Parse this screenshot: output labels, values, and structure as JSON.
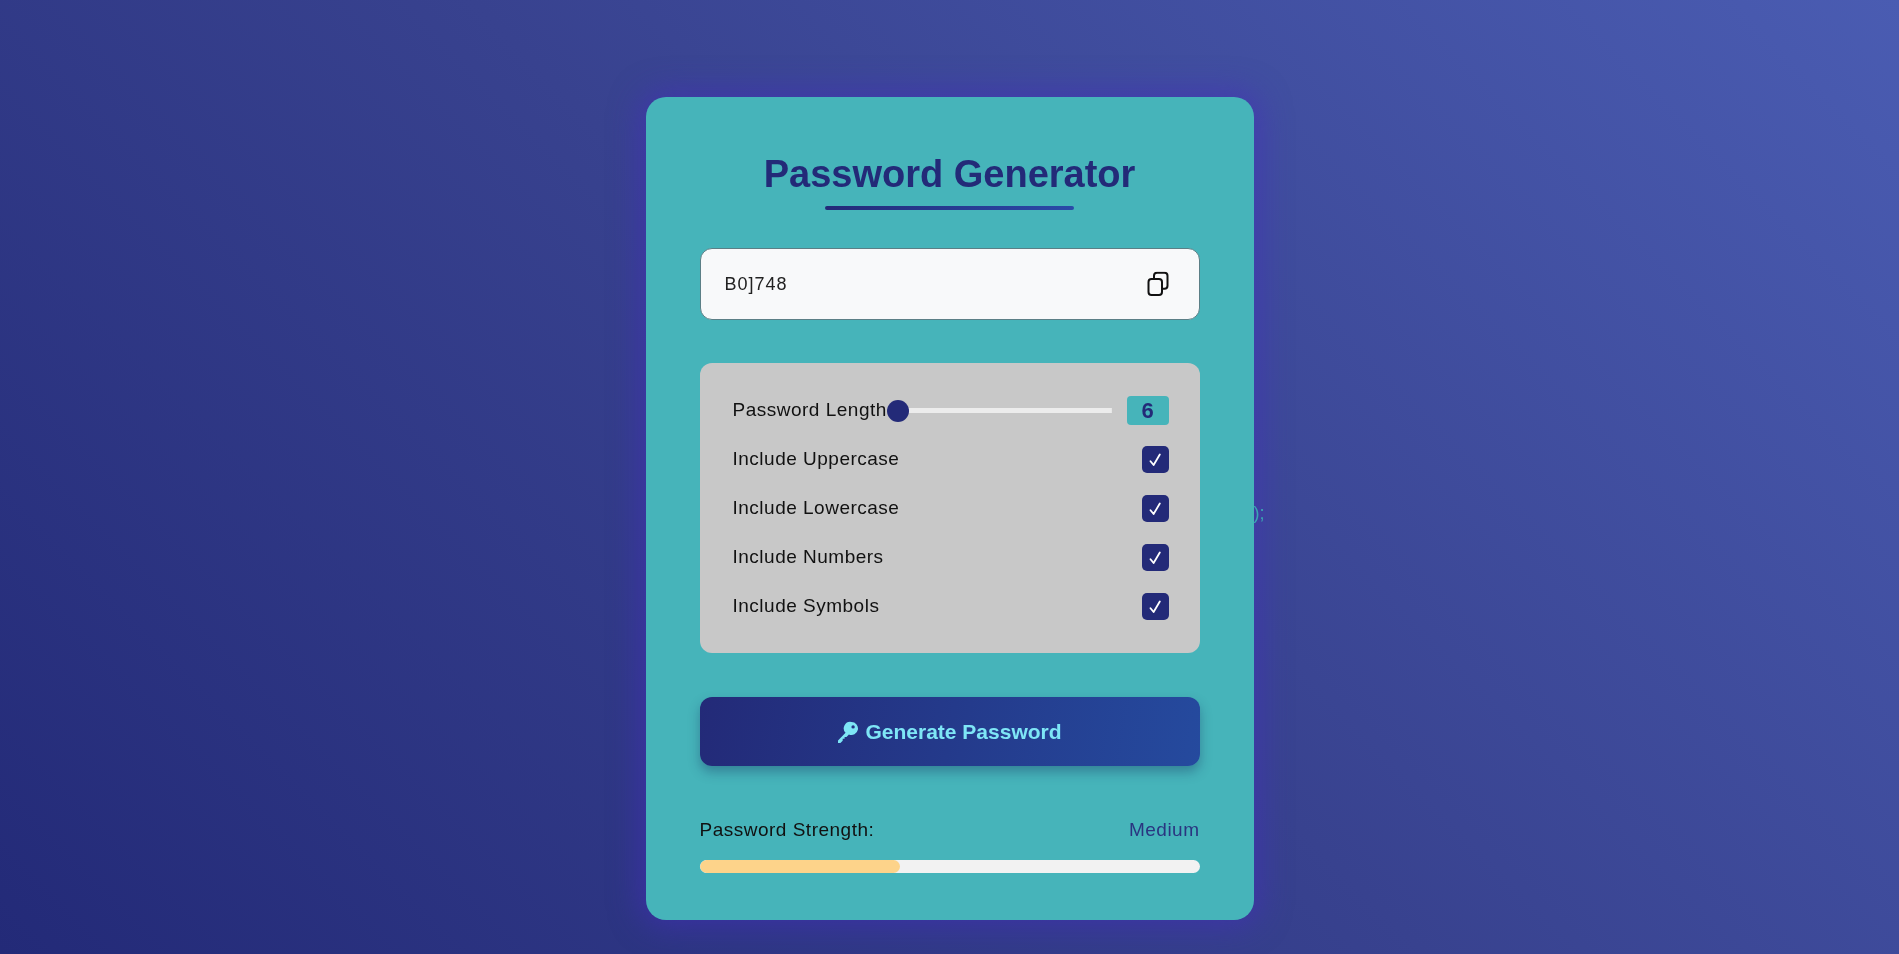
{
  "title": "Password Generator",
  "password_field": {
    "value": "B0]748"
  },
  "options": {
    "length": {
      "label": "Password Length",
      "level": 0,
      "value": "6"
    },
    "checkboxes": [
      {
        "label": "Include Uppercase",
        "checked": true
      },
      {
        "label": "Include Lowercase",
        "checked": true
      },
      {
        "label": "Include Numbers",
        "checked": true
      },
      {
        "label": "Include Symbols",
        "checked": true
      }
    ]
  },
  "generate_button": {
    "label": "Generate Password"
  },
  "strength": {
    "label": "Password Strength:",
    "value": "Medium",
    "level": 0.4
  },
  "stray_text": ");"
}
